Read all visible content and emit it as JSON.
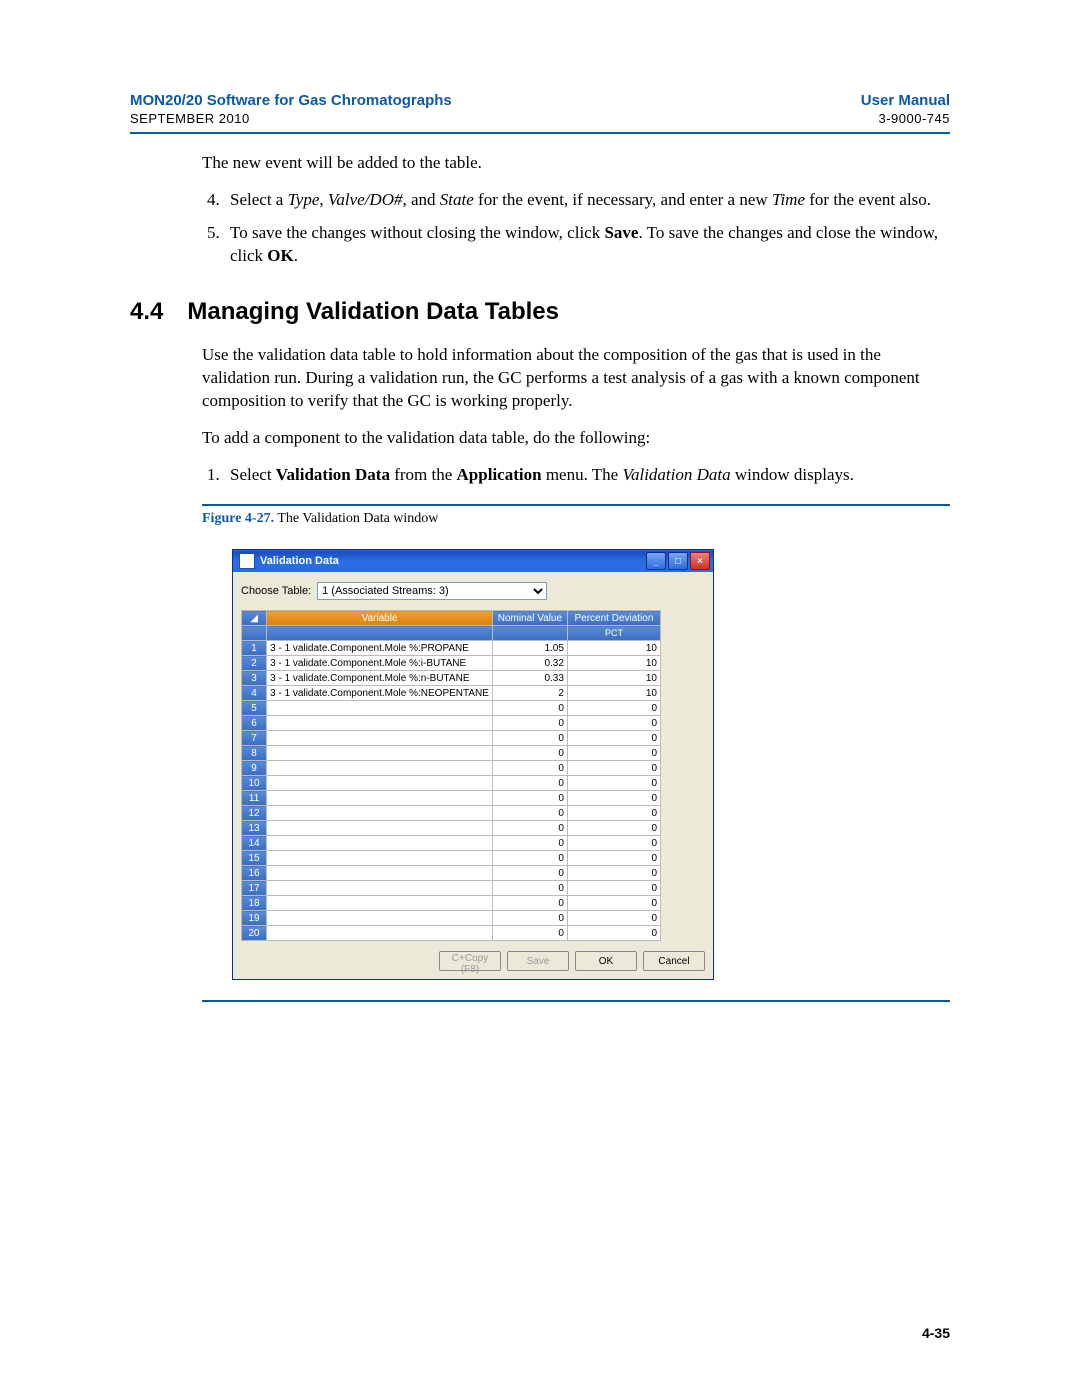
{
  "header": {
    "title": "MON20/20 Software for Gas Chromatographs",
    "right": "User Manual",
    "date": "SEPTEMBER 2010",
    "doc": "3-9000-745"
  },
  "body": {
    "intro": "The new event will be added to the table.",
    "step4_a": "Select a ",
    "step4_type": "Type",
    "step4_b": ", ",
    "step4_valve": "Valve/DO#",
    "step4_c": ", and ",
    "step4_state": "State",
    "step4_d": " for the event, if necessary, and enter a new ",
    "step4_time": "Time",
    "step4_e": " for the event also.",
    "step5_a": "To save the changes without closing the window, click ",
    "step5_save": "Save",
    "step5_b": ". To save the changes and close the window, click ",
    "step5_ok": "OK",
    "step5_c": ".",
    "section_num": "4.4",
    "section_title": "Managing Validation Data Tables",
    "para1": "Use the validation data table to hold information about the composition of the gas that is used in the validation run.  During a validation run, the GC performs a test analysis of a gas with a known component composition to verify that the GC is working properly.",
    "para2": "To add a component to the validation data table, do the following:",
    "step1_a": "Select ",
    "step1_vd": "Validation Data",
    "step1_b": " from the ",
    "step1_app": "Application",
    "step1_c": " menu.  The ",
    "step1_vd2": "Validation Data",
    "step1_d": " window displays."
  },
  "figure": {
    "num": "Figure 4-27.",
    "caption": "  The Validation Data window"
  },
  "dialog": {
    "title": "Validation Data",
    "choose_label": "Choose Table:",
    "choose_value": "1 (Associated Streams: 3)",
    "col_variable": "Variable",
    "col_nominal": "Nominal Value",
    "col_percent": "Percent Deviation",
    "sub_pct": "PCT",
    "rows": [
      {
        "n": "1",
        "var": "3 - 1 validate.Component.Mole %:PROPANE",
        "nom": "1.05",
        "pct": "10"
      },
      {
        "n": "2",
        "var": "3 - 1 validate.Component.Mole %:i-BUTANE",
        "nom": "0.32",
        "pct": "10"
      },
      {
        "n": "3",
        "var": "3 - 1 validate.Component.Mole %:n-BUTANE",
        "nom": "0.33",
        "pct": "10"
      },
      {
        "n": "4",
        "var": "3 - 1 validate.Component.Mole %:NEOPENTANE",
        "nom": "2",
        "pct": "10"
      },
      {
        "n": "5",
        "var": "",
        "nom": "0",
        "pct": "0"
      },
      {
        "n": "6",
        "var": "",
        "nom": "0",
        "pct": "0"
      },
      {
        "n": "7",
        "var": "",
        "nom": "0",
        "pct": "0"
      },
      {
        "n": "8",
        "var": "",
        "nom": "0",
        "pct": "0"
      },
      {
        "n": "9",
        "var": "",
        "nom": "0",
        "pct": "0"
      },
      {
        "n": "10",
        "var": "",
        "nom": "0",
        "pct": "0"
      },
      {
        "n": "11",
        "var": "",
        "nom": "0",
        "pct": "0"
      },
      {
        "n": "12",
        "var": "",
        "nom": "0",
        "pct": "0"
      },
      {
        "n": "13",
        "var": "",
        "nom": "0",
        "pct": "0"
      },
      {
        "n": "14",
        "var": "",
        "nom": "0",
        "pct": "0"
      },
      {
        "n": "15",
        "var": "",
        "nom": "0",
        "pct": "0"
      },
      {
        "n": "16",
        "var": "",
        "nom": "0",
        "pct": "0"
      },
      {
        "n": "17",
        "var": "",
        "nom": "0",
        "pct": "0"
      },
      {
        "n": "18",
        "var": "",
        "nom": "0",
        "pct": "0"
      },
      {
        "n": "19",
        "var": "",
        "nom": "0",
        "pct": "0"
      },
      {
        "n": "20",
        "var": "",
        "nom": "0",
        "pct": "0"
      }
    ],
    "btn_copy": "C+Copy (F8)",
    "btn_save": "Save",
    "btn_ok": "OK",
    "btn_cancel": "Cancel"
  },
  "footer": {
    "page": "4-35"
  }
}
